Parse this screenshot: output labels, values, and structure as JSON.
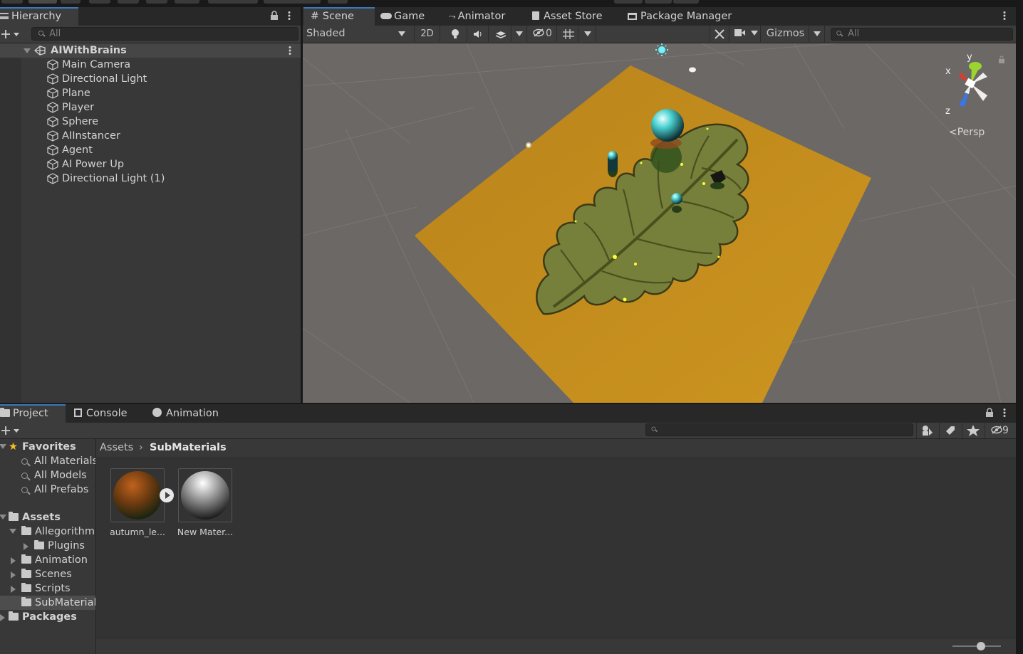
{
  "hierarchy": {
    "tab_label": "Hierarchy",
    "search_placeholder": "All",
    "scene_name": "AIWithBrains",
    "objects": [
      "Main Camera",
      "Directional Light",
      "Plane",
      "Player",
      "Sphere",
      "AIInstancer",
      "Agent",
      "AI Power Up",
      "Directional Light (1)"
    ]
  },
  "scene_tabs": {
    "scene": "Scene",
    "game": "Game",
    "animator": "Animator",
    "asset_store": "Asset Store",
    "package_manager": "Package Manager"
  },
  "scene_toolbar": {
    "shading_mode": "Shaded",
    "mode_2d": "2D",
    "hidden_count": "0",
    "gizmos_label": "Gizmos",
    "search_placeholder": "All"
  },
  "gizmo": {
    "x_label": "x",
    "y_label": "y",
    "z_label": "z",
    "projection": "Persp"
  },
  "bottom_tabs": {
    "project": "Project",
    "console": "Console",
    "animation": "Animation"
  },
  "project": {
    "hidden_packages_count": "9",
    "favorites_label": "Favorites",
    "favorites": [
      "All Materials",
      "All Models",
      "All Prefabs"
    ],
    "assets_label": "Assets",
    "asset_folders": [
      {
        "label": "Allegorithmic"
      },
      {
        "label": "Plugins"
      },
      {
        "label": "Animation"
      },
      {
        "label": "Scenes"
      },
      {
        "label": "Scripts"
      },
      {
        "label": "SubMaterials"
      }
    ],
    "packages_label": "Packages",
    "breadcrumb_root": "Assets",
    "breadcrumb_current": "SubMaterials",
    "assets": [
      {
        "name": "autumn_le..."
      },
      {
        "name": "New Mater..."
      }
    ]
  },
  "colors": {
    "accent": "#3a79bb",
    "panel_bg": "#383838",
    "toolbar_bg": "#3c3c3c",
    "scene_bg": "#6c6866",
    "plane": "#c8911c",
    "leaf": "#78843a"
  }
}
